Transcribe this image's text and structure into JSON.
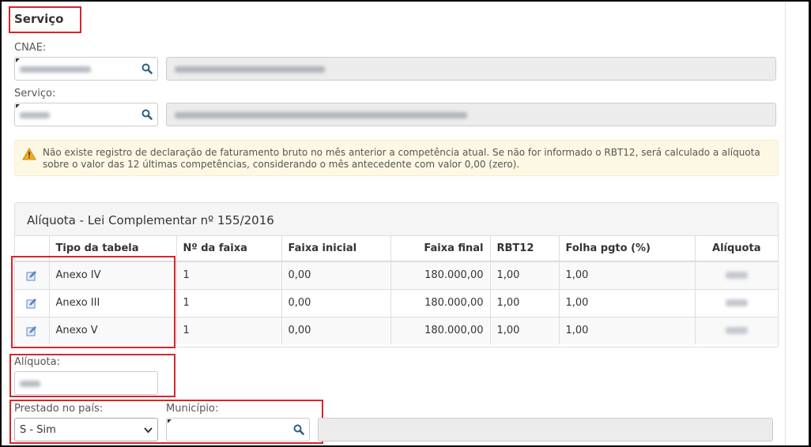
{
  "section": {
    "title": "Serviço"
  },
  "cnae": {
    "label": "CNAE:",
    "code_blurred": true,
    "description_blurred": true,
    "search_icon": "search-icon"
  },
  "servico": {
    "label": "Serviço:",
    "code_blurred": true,
    "description_blurred": true,
    "search_icon": "search-icon"
  },
  "alert": {
    "icon": "warning-icon",
    "message": "Não existe registro de declaração de faturamento bruto no mês anterior a competência atual. Se não for informado o RBT12, será calculado a alíquota sobre o valor das 12 últimas competências, considerando o mês antecedente com valor 0,00 (zero)."
  },
  "aliquota_panel": {
    "title": "Alíquota - Lei Complementar nº 155/2016",
    "columns": [
      "",
      "Tipo da tabela",
      "Nº da faixa",
      "Faixa inicial",
      "Faixa final",
      "RBT12",
      "Folha pgto (%)",
      "Alíquota"
    ],
    "rows": [
      {
        "tipo": "Anexo IV",
        "faixa": "1",
        "inicial": "0,00",
        "final": "180.000,00",
        "rbt12": "1,00",
        "folha": "1,00"
      },
      {
        "tipo": "Anexo III",
        "faixa": "1",
        "inicial": "0,00",
        "final": "180.000,00",
        "rbt12": "1,00",
        "folha": "1,00"
      },
      {
        "tipo": "Anexo V",
        "faixa": "1",
        "inicial": "0,00",
        "final": "180.000,00",
        "rbt12": "1,00",
        "folha": "1,00"
      }
    ]
  },
  "aliquota_field": {
    "label": "Alíquota:"
  },
  "prestado": {
    "label": "Prestado no país:",
    "selected": "S - Sim"
  },
  "municipio": {
    "label": "Município:"
  },
  "colors": {
    "highlight": "#d9232d",
    "alert_bg": "#fcf8e3",
    "readonly_bg": "#ececec"
  }
}
